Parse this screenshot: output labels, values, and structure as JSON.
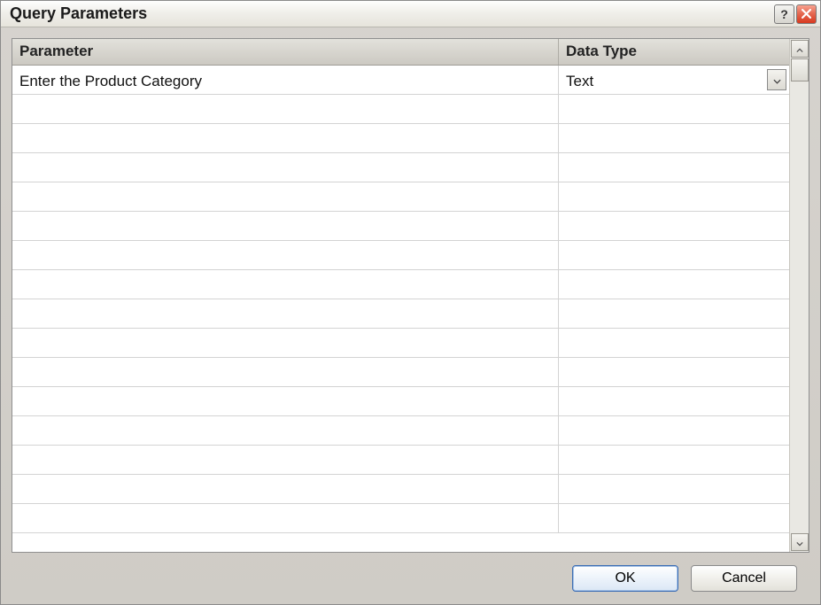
{
  "window": {
    "title": "Query Parameters"
  },
  "grid": {
    "columns": {
      "parameter": "Parameter",
      "data_type": "Data Type"
    },
    "rows": [
      {
        "parameter": "Enter the Product Category",
        "data_type": "Text"
      },
      {
        "parameter": "",
        "data_type": ""
      },
      {
        "parameter": "",
        "data_type": ""
      },
      {
        "parameter": "",
        "data_type": ""
      },
      {
        "parameter": "",
        "data_type": ""
      },
      {
        "parameter": "",
        "data_type": ""
      },
      {
        "parameter": "",
        "data_type": ""
      },
      {
        "parameter": "",
        "data_type": ""
      },
      {
        "parameter": "",
        "data_type": ""
      },
      {
        "parameter": "",
        "data_type": ""
      },
      {
        "parameter": "",
        "data_type": ""
      },
      {
        "parameter": "",
        "data_type": ""
      },
      {
        "parameter": "",
        "data_type": ""
      },
      {
        "parameter": "",
        "data_type": ""
      },
      {
        "parameter": "",
        "data_type": ""
      },
      {
        "parameter": "",
        "data_type": ""
      }
    ]
  },
  "buttons": {
    "ok": "OK",
    "cancel": "Cancel"
  }
}
